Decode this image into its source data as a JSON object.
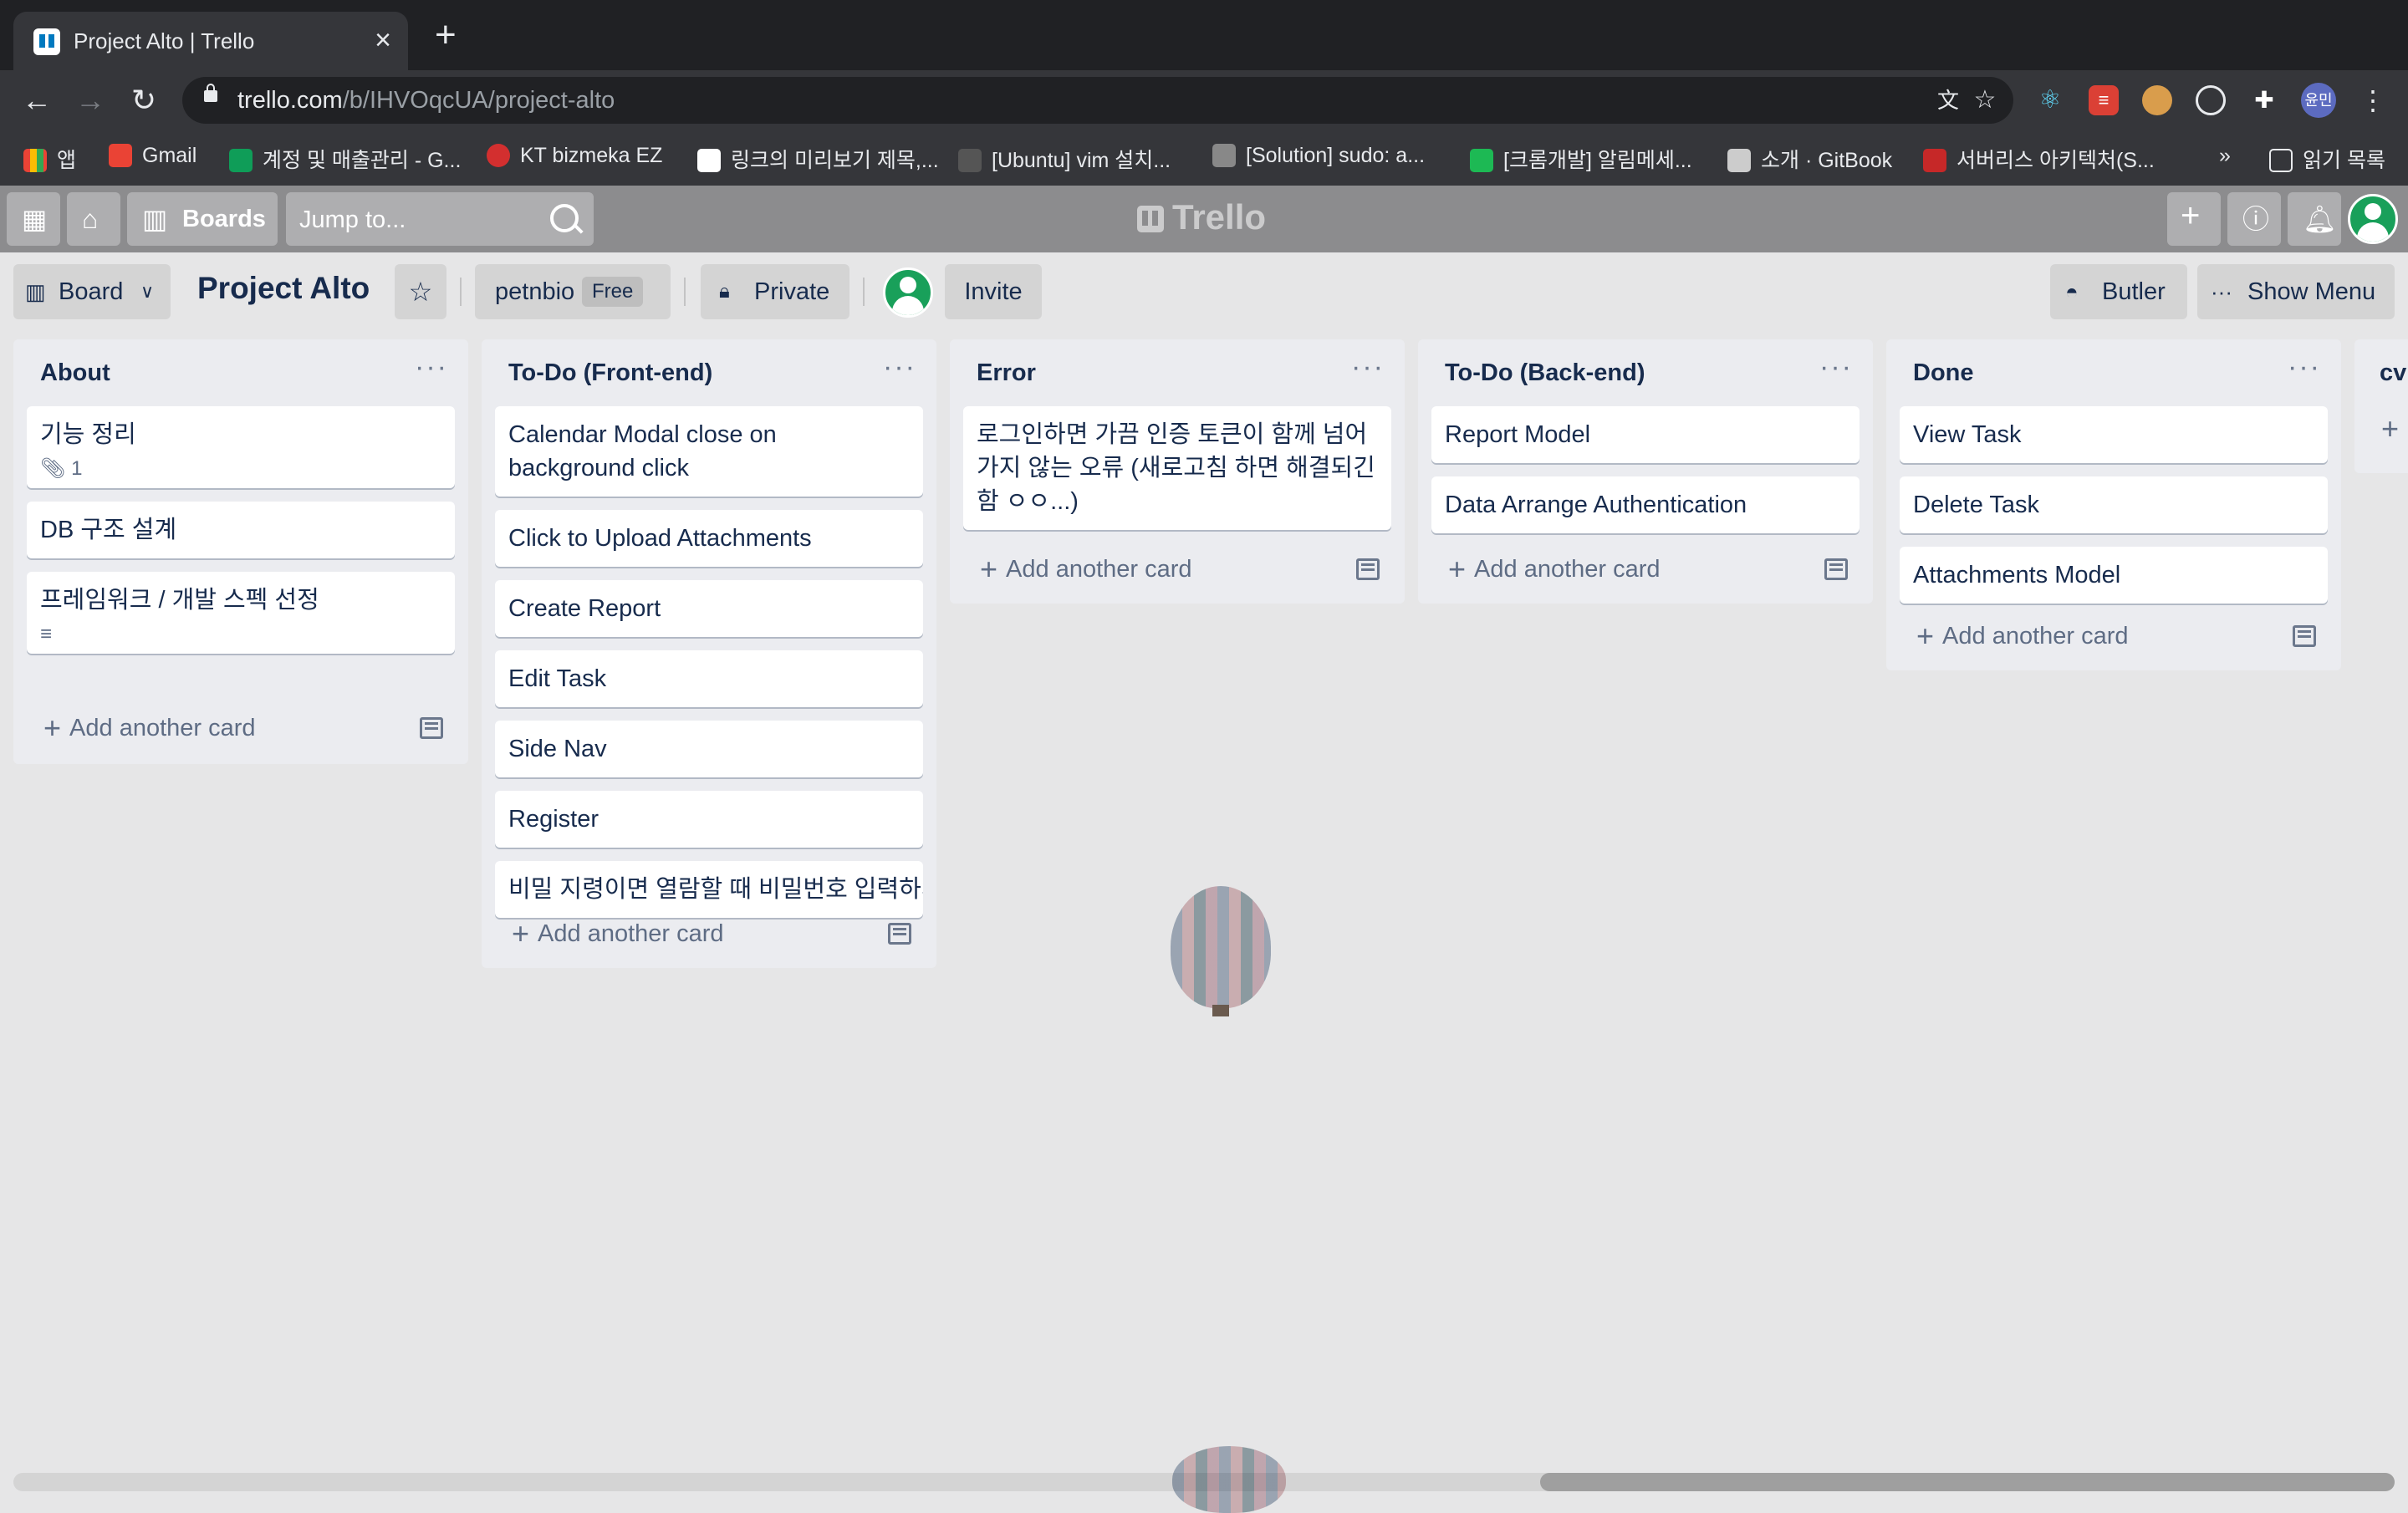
{
  "browser": {
    "tab_title": "Project Alto | Trello",
    "url_host": "trello.com",
    "url_path": "/b/IHVOqcUA/project-alto",
    "profile_initials": "윤민",
    "bookmarks": [
      {
        "label": "앱"
      },
      {
        "label": "Gmail"
      },
      {
        "label": "계정 및 매출관리 - G..."
      },
      {
        "label": "KT bizmeka EZ"
      },
      {
        "label": "링크의 미리보기 제목,..."
      },
      {
        "label": "[Ubuntu] vim 설치..."
      },
      {
        "label": "[Solution] sudo: a..."
      },
      {
        "label": "[크롬개발] 알림메세..."
      },
      {
        "label": "소개 · GitBook"
      },
      {
        "label": "서버리스 아키텍처(S..."
      }
    ],
    "bookmarks_overflow": "»",
    "reading_list": "읽기 목록"
  },
  "trello_header": {
    "boards_label": "Boards",
    "search_placeholder": "Jump to...",
    "logo_text": "Trello"
  },
  "board_header": {
    "view_label": "Board",
    "title": "Project Alto",
    "team_name": "petnbio",
    "team_plan": "Free",
    "visibility": "Private",
    "invite_label": "Invite",
    "butler_label": "Butler",
    "show_menu_label": "Show Menu"
  },
  "lists": [
    {
      "title": "About",
      "cards": [
        {
          "text": "기능 정리",
          "attachments": "1"
        },
        {
          "text": "DB 구조 설계"
        },
        {
          "text": "프레임워크 / 개발 스펙 선정",
          "has_description": true
        }
      ]
    },
    {
      "title": "To-Do (Front-end)",
      "cards": [
        {
          "text": "Calendar Modal close on background click"
        },
        {
          "text": "Click to Upload Attachments"
        },
        {
          "text": "Create Report"
        },
        {
          "text": "Edit Task"
        },
        {
          "text": "Side Nav"
        },
        {
          "text": "Register"
        },
        {
          "text": "비밀 지령이면 열람할 때 비밀번호 입력하게"
        }
      ]
    },
    {
      "title": "Error",
      "cards": [
        {
          "text": "로그인하면 가끔 인증 토큰이 함께 넘어가지 않는 오류 (새로고침 하면 해결되긴 함 ㅇㅇ...)"
        }
      ]
    },
    {
      "title": "To-Do (Back-end)",
      "cards": [
        {
          "text": "Report Model"
        },
        {
          "text": "Data Arrange Authentication"
        }
      ]
    },
    {
      "title": "Done",
      "cards": [
        {
          "text": "View Task"
        },
        {
          "text": "Delete Task"
        },
        {
          "text": "Attachments Model"
        }
      ]
    }
  ],
  "partial_list_title": "cv",
  "add_card_label": "Add another card",
  "colors": {
    "trello_blue": "#0079bf",
    "header_gray": "#8c8c8e",
    "list_bg": "#ebecf0",
    "avatar_green": "#19a05a"
  }
}
